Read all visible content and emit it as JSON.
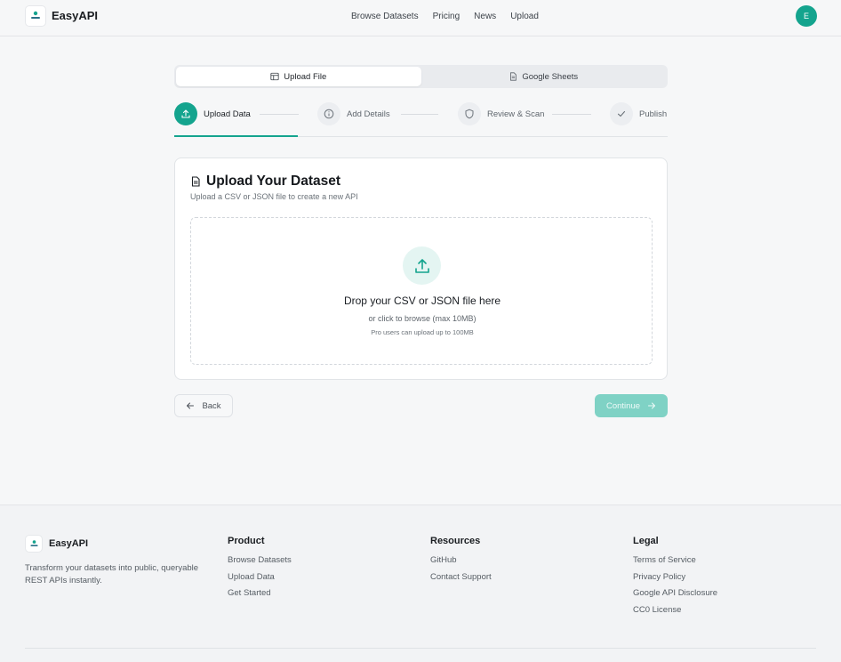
{
  "header": {
    "logo_alt": "EasyAPI",
    "brand": "EasyAPI",
    "nav": [
      "Browse Datasets",
      "Pricing",
      "News",
      "Upload"
    ],
    "avatar_initial": "E"
  },
  "tabs": [
    {
      "label": "Upload File",
      "icon": "table-icon",
      "active": true
    },
    {
      "label": "Google Sheets",
      "icon": "sheet-icon",
      "active": false
    }
  ],
  "steps": [
    {
      "label": "Upload Data",
      "icon": "upload-icon",
      "active": true
    },
    {
      "label": "Add Details",
      "icon": "info-icon",
      "active": false
    },
    {
      "label": "Review & Scan",
      "icon": "shield-icon",
      "active": false
    },
    {
      "label": "Publish",
      "icon": "check-icon",
      "active": false
    }
  ],
  "card": {
    "title": "Upload Your Dataset",
    "subtitle": "Upload a CSV or JSON file to create a new API",
    "drop_title": "Drop your CSV or JSON file here",
    "drop_sub": "or click to browse (max 10MB)",
    "drop_pro": "Pro users can upload up to 100MB"
  },
  "actions": {
    "back": "Back",
    "continue": "Continue"
  },
  "footer": {
    "brand": "EasyAPI",
    "tagline": "Transform your datasets into public, queryable REST APIs instantly.",
    "columns": [
      {
        "title": "Product",
        "links": [
          "Browse Datasets",
          "Upload Data",
          "Get Started"
        ]
      },
      {
        "title": "Resources",
        "links": [
          "GitHub",
          "Contact Support"
        ]
      },
      {
        "title": "Legal",
        "links": [
          "Terms of Service",
          "Privacy Policy",
          "Google API Disclosure",
          "CC0 License"
        ]
      }
    ]
  },
  "colors": {
    "accent": "#14a48e",
    "accent_light": "#e4f5f2",
    "continue_disabled": "#7fd2c5"
  }
}
